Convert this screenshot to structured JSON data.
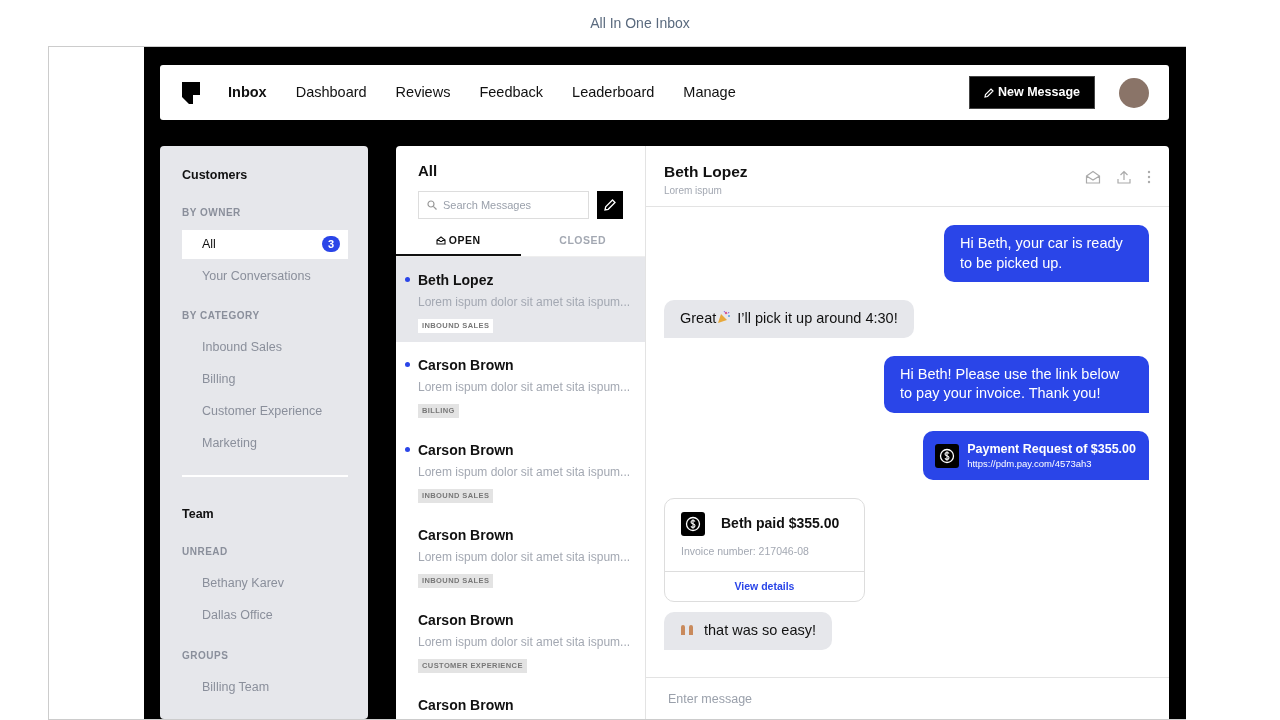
{
  "page_title": "All In One Inbox",
  "nav": {
    "items": [
      {
        "label": "Inbox",
        "selected": true
      },
      {
        "label": "Dashboard",
        "selected": false
      },
      {
        "label": "Reviews",
        "selected": false
      },
      {
        "label": "Feedback",
        "selected": false
      },
      {
        "label": "Leaderboard",
        "selected": false
      },
      {
        "label": "Manage",
        "selected": false
      }
    ],
    "new_message_button": "New Message"
  },
  "sidebar": {
    "sections": [
      {
        "title": "Customers",
        "groups": [
          {
            "heading": "BY OWNER",
            "items": [
              {
                "label": "All",
                "badge": "3",
                "selected": true
              },
              {
                "label": "Your Conversations",
                "selected": false
              }
            ]
          },
          {
            "heading": "BY CATEGORY",
            "items": [
              {
                "label": "Inbound Sales",
                "selected": false
              },
              {
                "label": "Billing",
                "selected": false
              },
              {
                "label": "Customer Experience",
                "selected": false
              },
              {
                "label": "Marketing",
                "selected": false
              }
            ]
          }
        ]
      },
      {
        "title": "Team",
        "groups": [
          {
            "heading": "UNREAD",
            "items": [
              {
                "label": "Bethany Karev",
                "selected": false
              },
              {
                "label": "Dallas Office",
                "selected": false
              }
            ]
          },
          {
            "heading": "GROUPS",
            "items": [
              {
                "label": "Billing Team",
                "selected": false
              }
            ]
          }
        ]
      }
    ]
  },
  "conversation_list": {
    "title": "All",
    "search": {
      "placeholder": "Search Messages"
    },
    "tabs": [
      {
        "label": "OPEN",
        "selected": true
      },
      {
        "label": "CLOSED",
        "selected": false
      }
    ],
    "items": [
      {
        "name": "Beth Lopez",
        "preview": "Lorem ispum dolor sit amet sita ispum...",
        "tag": "INBOUND SALES",
        "unread": true,
        "selected": true
      },
      {
        "name": "Carson Brown",
        "preview": "Lorem ispum dolor sit amet sita ispum...",
        "tag": "BILLING",
        "unread": true,
        "selected": false
      },
      {
        "name": "Carson Brown",
        "preview": "Lorem ispum dolor sit amet sita ispum...",
        "tag": "INBOUND SALES",
        "unread": true,
        "selected": false
      },
      {
        "name": "Carson Brown",
        "preview": "Lorem ispum dolor sit amet sita ispum...",
        "tag": "INBOUND SALES",
        "unread": false,
        "selected": false
      },
      {
        "name": "Carson Brown",
        "preview": "Lorem ispum dolor sit amet sita ispum...",
        "tag": "CUSTOMER EXPERIENCE",
        "unread": false,
        "selected": false
      },
      {
        "name": "Carson Brown",
        "unread": false,
        "selected": false
      }
    ]
  },
  "chat": {
    "contact": "Beth Lopez",
    "subtitle": "Lorem ispum",
    "messages": [
      {
        "kind": "outgoing",
        "text": "Hi Beth, your car is ready to be picked up."
      },
      {
        "kind": "incoming",
        "text_before": "Great",
        "text": "I’ll pick it up around 4:30!"
      },
      {
        "kind": "outgoing",
        "text": "Hi Beth! Please use the link below to pay your invoice. Thank you!"
      },
      {
        "kind": "payment_request",
        "title": "Payment Request of $355.00",
        "link": "https://pdm.pay.com/4573ah3"
      },
      {
        "kind": "payment_receipt",
        "title": "Beth paid $355.00",
        "detail": "Invoice number: 217046-08",
        "action": "View details"
      },
      {
        "kind": "incoming",
        "text": "that was so easy!"
      }
    ],
    "composer": {
      "placeholder": "Enter message"
    }
  }
}
